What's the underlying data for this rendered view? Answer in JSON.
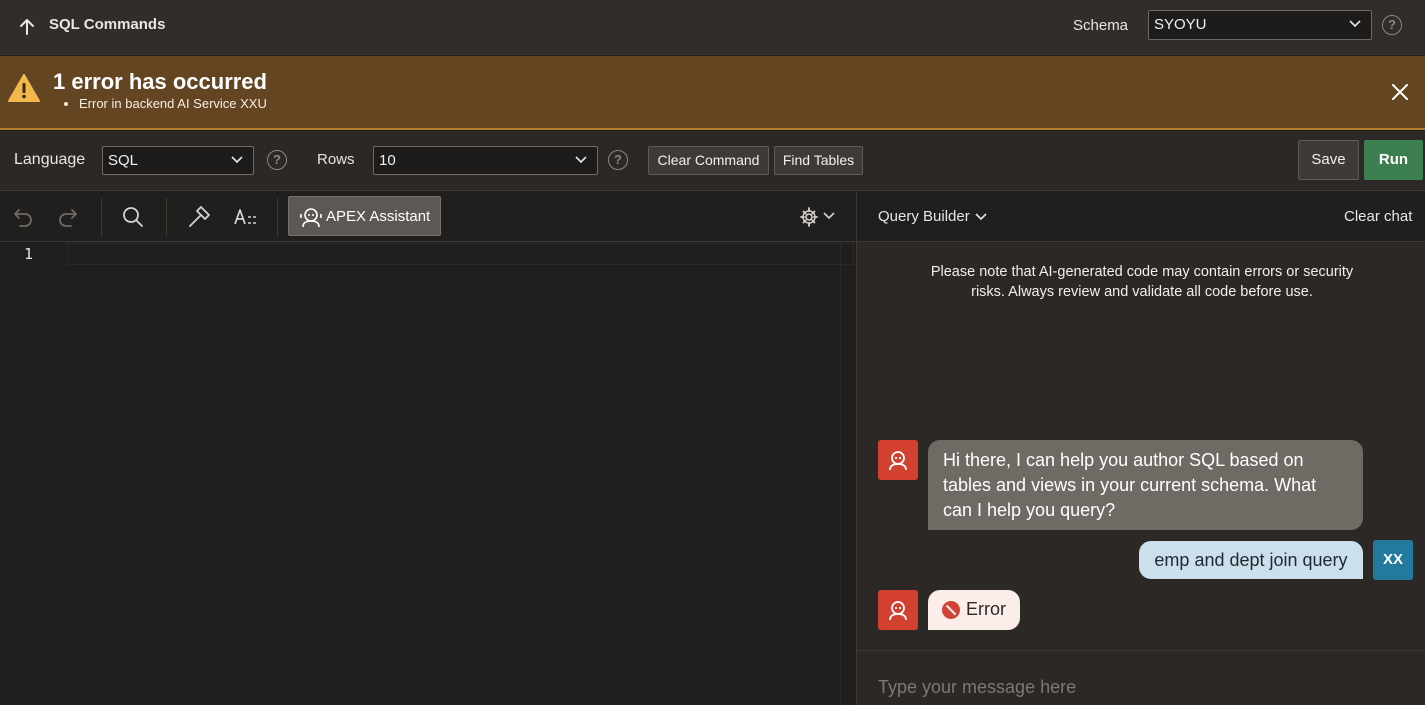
{
  "header": {
    "title": "SQL Commands",
    "schema_label": "Schema",
    "schema_value": "SYOYU",
    "help_glyph": "?"
  },
  "alert": {
    "title": "1 error has occurred",
    "messages": [
      "Error in backend AI Service XXU"
    ]
  },
  "toolbar": {
    "language_label": "Language",
    "language_value": "SQL",
    "rows_label": "Rows",
    "rows_value": "10",
    "clear_command_label": "Clear Command",
    "find_tables_label": "Find Tables",
    "save_label": "Save",
    "run_label": "Run"
  },
  "editor": {
    "assistant_label": "APEX Assistant",
    "line_numbers": [
      "1"
    ],
    "content": ""
  },
  "chat": {
    "mode_label": "Query Builder",
    "clear_label": "Clear chat",
    "disclaimer": "Please note that AI-generated code may contain errors or security risks. Always review and validate all code before use.",
    "messages": [
      {
        "role": "assistant",
        "text": "Hi there, I can help you author SQL based on tables and views in your current schema. What can I help you query?"
      },
      {
        "role": "user",
        "text": "emp and dept join query",
        "initials": "XX"
      },
      {
        "role": "assistant",
        "status": "error",
        "text": "Error"
      }
    ],
    "input_placeholder": "Type your message here"
  },
  "colors": {
    "accent_run": "#3b7f4e",
    "banner_bg": "#644522",
    "bot_avatar": "#d3402f",
    "user_avatar": "#227a9c",
    "error_red": "#d04437"
  }
}
